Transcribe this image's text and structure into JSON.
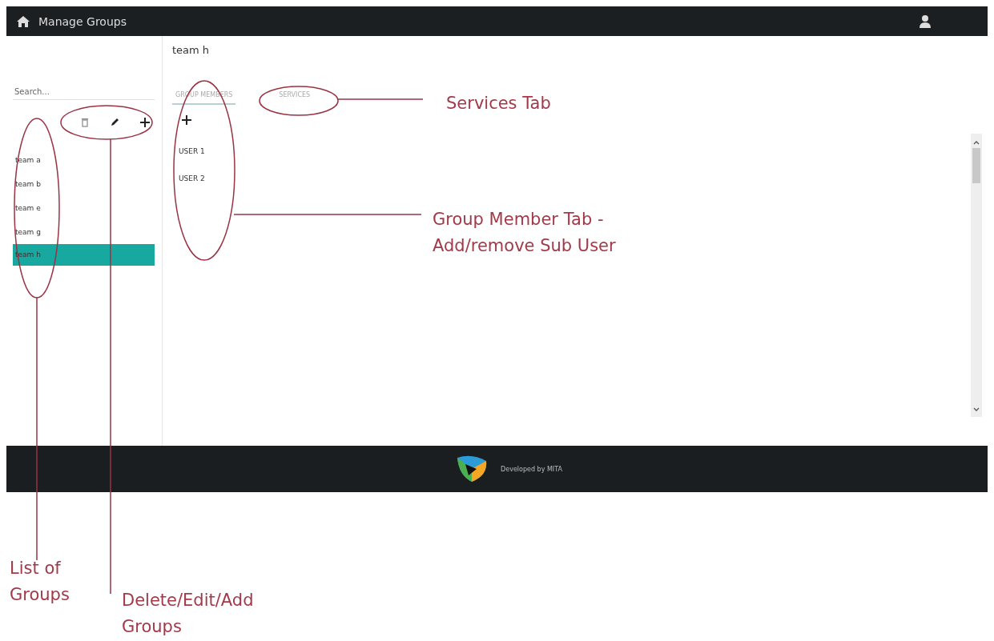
{
  "app_bar": {
    "title": "Manage Groups"
  },
  "sidebar": {
    "search": {
      "placeholder": "Search..."
    },
    "groups": [
      {
        "label": "team a",
        "selected": false
      },
      {
        "label": "team b",
        "selected": false
      },
      {
        "label": "team e",
        "selected": false
      },
      {
        "label": "team g",
        "selected": false
      },
      {
        "label": "team h",
        "selected": true
      }
    ]
  },
  "detail": {
    "title": "team h",
    "tabs": [
      {
        "label": "GROUP MEMBERS",
        "selected": true
      },
      {
        "label": "SERVICES",
        "selected": false
      }
    ],
    "members": [
      "USER 1",
      "USER 2"
    ]
  },
  "footer": {
    "text": "Developed by MITA"
  },
  "annotations": [
    "Services Tab",
    "Group Member Tab - Add/remove Sub User",
    "List of Groups",
    "Delete/Edit/Add Groups"
  ]
}
